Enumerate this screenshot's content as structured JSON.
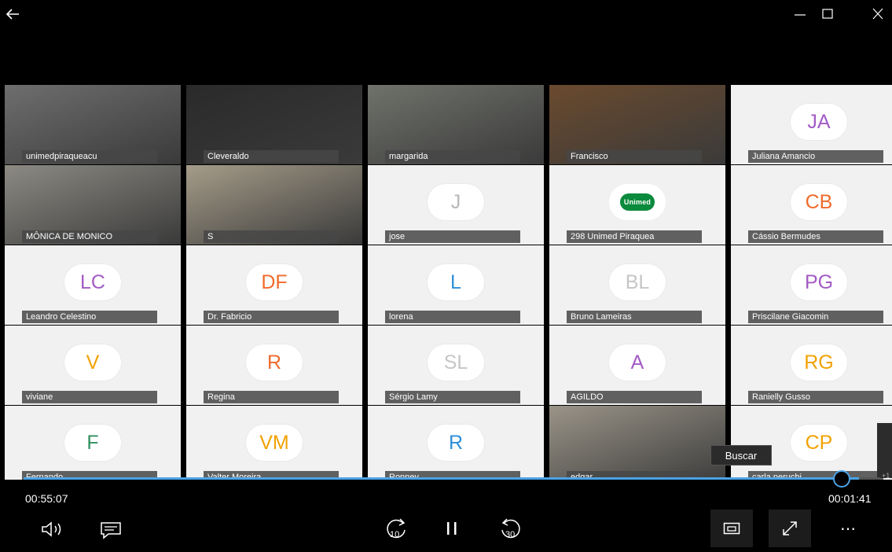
{
  "window": {
    "back_icon": "arrow-left-icon"
  },
  "participants": [
    {
      "name": "unimedpiraqueacu",
      "type": "video",
      "bg": "#6e6e6e"
    },
    {
      "name": "Cleveraldo",
      "type": "video",
      "bg": "#2a2a2a"
    },
    {
      "name": "margarida",
      "type": "video",
      "bg": "#6f726b"
    },
    {
      "name": "Francisco",
      "type": "video",
      "bg": "#6a4a2e"
    },
    {
      "name": "Juliana Amancio",
      "type": "avatar",
      "initials": "JA",
      "color": "#a35bc5"
    },
    {
      "name": "MÔNICA DE MONICO",
      "type": "video",
      "bg": "#8c8a83"
    },
    {
      "name": "S",
      "type": "video",
      "bg": "#a59c89"
    },
    {
      "name": "jose",
      "type": "avatar",
      "initials": "J",
      "color": "#b8b8b8"
    },
    {
      "name": "298 Unimed Piraquea",
      "type": "logo",
      "logo_text": "Unimed"
    },
    {
      "name": "Cássio Bermudes",
      "type": "avatar",
      "initials": "CB",
      "color": "#f06b2b"
    },
    {
      "name": "Leandro Celestino",
      "type": "avatar",
      "initials": "LC",
      "color": "#a35bc5"
    },
    {
      "name": "Dr. Fabricio",
      "type": "avatar",
      "initials": "DF",
      "color": "#f06b2b"
    },
    {
      "name": "lorena",
      "type": "avatar",
      "initials": "L",
      "color": "#2e8fd8"
    },
    {
      "name": "Bruno Lameiras",
      "type": "avatar",
      "initials": "BL",
      "color": "#c6c6c6"
    },
    {
      "name": "Priscilane Giacomin",
      "type": "avatar",
      "initials": "PG",
      "color": "#a35bc5"
    },
    {
      "name": "viviane",
      "type": "avatar",
      "initials": "V",
      "color": "#f2a100"
    },
    {
      "name": "Regina",
      "type": "avatar",
      "initials": "R",
      "color": "#f06b2b"
    },
    {
      "name": "Sérgio Lamy",
      "type": "avatar",
      "initials": "SL",
      "color": "#c6c6c6"
    },
    {
      "name": "AGILDO",
      "type": "avatar",
      "initials": "A",
      "color": "#a35bc5"
    },
    {
      "name": "Ranielly Gusso",
      "type": "avatar",
      "initials": "RG",
      "color": "#f2a100"
    },
    {
      "name": "Fernando",
      "type": "avatar",
      "initials": "F",
      "color": "#2f8f5e"
    },
    {
      "name": "Valter Moreira",
      "type": "avatar",
      "initials": "VM",
      "color": "#f2a100"
    },
    {
      "name": "Ronney",
      "type": "avatar",
      "initials": "R",
      "color": "#2e8fd8"
    },
    {
      "name": "edgar",
      "type": "video",
      "bg": "#9a9488"
    },
    {
      "name": "carla peruchi",
      "type": "avatar",
      "initials": "CP",
      "color": "#f2a100"
    }
  ],
  "tooltip": "Buscar",
  "player": {
    "elapsed": "00:55:07",
    "remaining": "00:01:41",
    "progress_fraction": 0.975,
    "extra_count_label": "+1",
    "accent": "#4aa3e8"
  }
}
